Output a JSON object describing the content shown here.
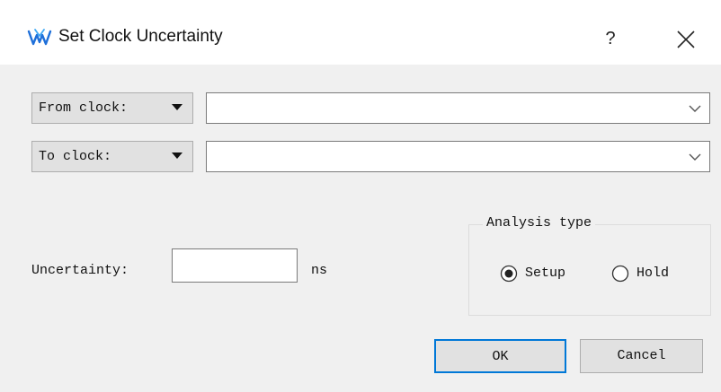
{
  "window": {
    "title": "Set Clock Uncertainty",
    "help_symbol": "?",
    "icons": {
      "app": "gowin-logo-icon",
      "close": "close-icon"
    }
  },
  "from_clock": {
    "label": "From clock:",
    "value": ""
  },
  "to_clock": {
    "label": "To clock:",
    "value": ""
  },
  "uncertainty": {
    "label": "Uncertainty:",
    "value": "",
    "unit": "ns"
  },
  "analysis_type": {
    "title": "Analysis type",
    "options": [
      {
        "label": "Setup",
        "selected": true
      },
      {
        "label": "Hold",
        "selected": false
      }
    ]
  },
  "buttons": {
    "ok": "OK",
    "cancel": "Cancel"
  },
  "colors": {
    "focus_border": "#0078d7",
    "logo": "#1e6fd9",
    "client_bg": "#f0f0f0"
  }
}
